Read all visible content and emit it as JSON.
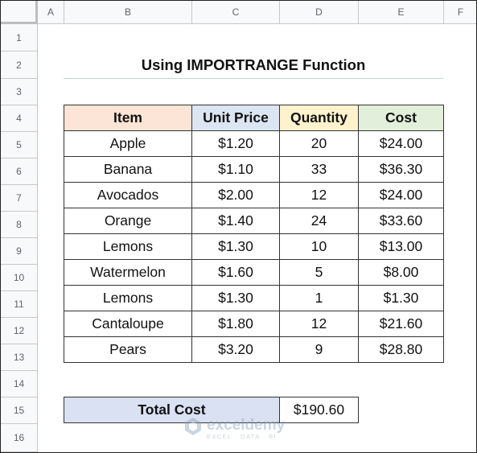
{
  "columns": [
    "A",
    "B",
    "C",
    "D",
    "E",
    "F"
  ],
  "rows": [
    "1",
    "2",
    "3",
    "4",
    "5",
    "6",
    "7",
    "8",
    "9",
    "10",
    "11",
    "12",
    "13",
    "14",
    "15",
    "16"
  ],
  "title": "Using IMPORTRANGE Function",
  "table": {
    "headers": {
      "item": "Item",
      "unit_price": "Unit Price",
      "quantity": "Quantity",
      "cost": "Cost"
    },
    "header_colors": {
      "item": "#fce4d6",
      "unit_price": "#dce6f2",
      "quantity": "#fff2cc",
      "cost": "#e2efda"
    },
    "rows": [
      {
        "item": "Apple",
        "unit_price": "$1.20",
        "quantity": "20",
        "cost": "$24.00"
      },
      {
        "item": "Banana",
        "unit_price": "$1.10",
        "quantity": "33",
        "cost": "$36.30"
      },
      {
        "item": "Avocados",
        "unit_price": "$2.00",
        "quantity": "12",
        "cost": "$24.00"
      },
      {
        "item": "Orange",
        "unit_price": "$1.40",
        "quantity": "24",
        "cost": "$33.60"
      },
      {
        "item": "Lemons",
        "unit_price": "$1.30",
        "quantity": "10",
        "cost": "$13.00"
      },
      {
        "item": "Watermelon",
        "unit_price": "$1.60",
        "quantity": "5",
        "cost": "$8.00"
      },
      {
        "item": "Lemons",
        "unit_price": "$1.30",
        "quantity": "1",
        "cost": "$1.30"
      },
      {
        "item": "Cantaloupe",
        "unit_price": "$1.80",
        "quantity": "12",
        "cost": "$21.60"
      },
      {
        "item": "Pears",
        "unit_price": "$3.20",
        "quantity": "9",
        "cost": "$28.80"
      }
    ]
  },
  "total": {
    "label": "Total Cost",
    "value": "$190.60",
    "label_color": "#d9e1f2"
  },
  "watermark": {
    "name": "exceldemy",
    "tagline": "EXCEL · DATA · BI",
    "icon": "exceldemy-logo-icon"
  }
}
